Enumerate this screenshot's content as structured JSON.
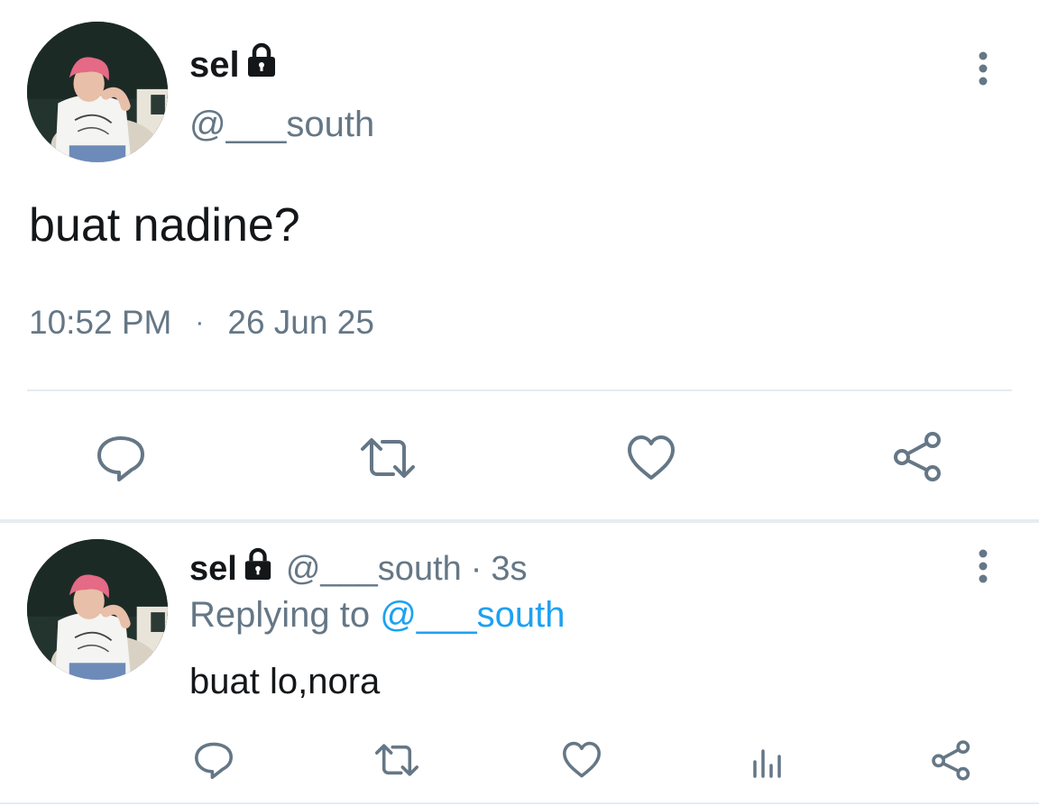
{
  "tweet": {
    "display_name": "sel",
    "handle": "@___south",
    "text": "buat nadine?",
    "time": "10:52 PM",
    "separator": "·",
    "date": "26 Jun 25"
  },
  "reply": {
    "display_name": "sel",
    "handle": "@___south",
    "separator": "·",
    "age": "3s",
    "replying_prefix": "Replying to",
    "replying_to": "@___south",
    "text": "buat lo,nora"
  },
  "icons": {
    "lock": "lock-icon",
    "more": "more-vertical-icon",
    "reply": "comment-icon",
    "retweet": "retweet-icon",
    "like": "heart-icon",
    "share": "share-icon",
    "analytics": "analytics-icon"
  },
  "colors": {
    "text": "#14171a",
    "secondary": "#657786",
    "link": "#1da1f2",
    "divider": "#e6ecf0"
  }
}
